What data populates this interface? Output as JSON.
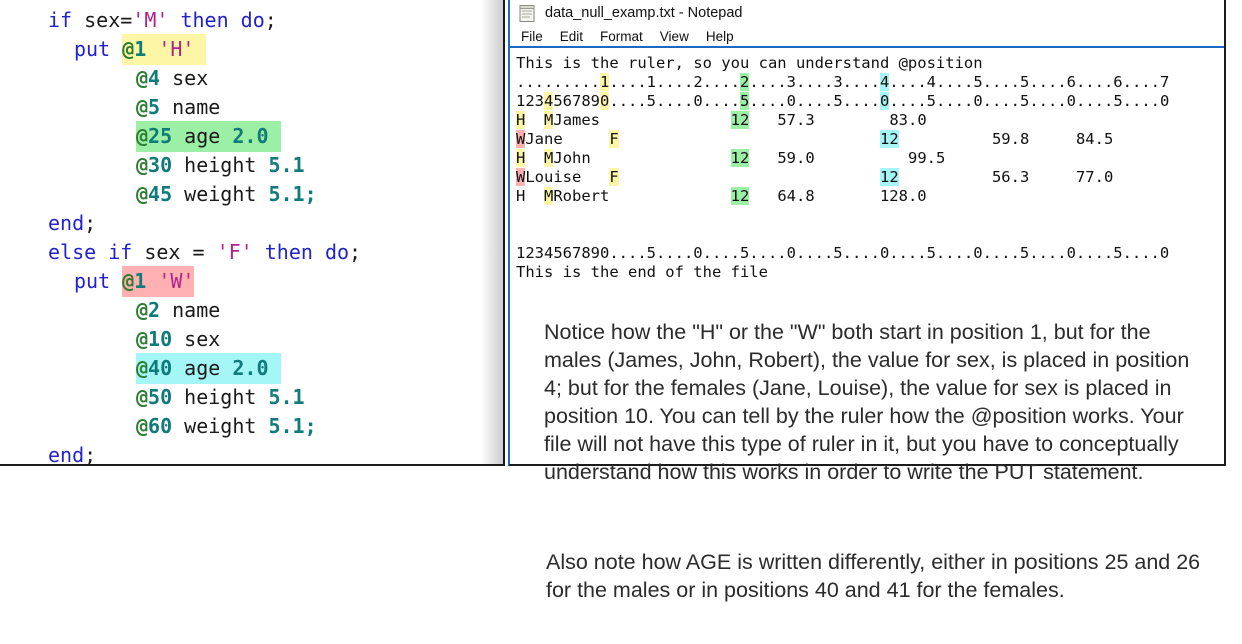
{
  "code_panel": {
    "language": "sas",
    "lines": [
      {
        "indent": "ind1",
        "parts": [
          {
            "t": "if ",
            "c": "kw"
          },
          {
            "t": "sex=",
            "c": "plain"
          },
          {
            "t": "'M'",
            "c": "str"
          },
          {
            "t": " ",
            "c": "plain"
          },
          {
            "t": "then do",
            "c": "kw"
          },
          {
            "t": ";",
            "c": "plain"
          }
        ]
      },
      {
        "indent": "ind2",
        "parts": [
          {
            "t": "put ",
            "c": "kw"
          },
          {
            "t": "@",
            "c": "at",
            "hl": "hl-yellow"
          },
          {
            "t": "1",
            "c": "num",
            "hl": "hl-yellow"
          },
          {
            "t": " ",
            "c": "plain",
            "hl": "hl-yellow"
          },
          {
            "t": "'H'",
            "c": "str",
            "hl": "hl-yellow"
          },
          {
            "t": " ",
            "c": "plain",
            "hl": "hl-yellow"
          }
        ]
      },
      {
        "indent": "ind3",
        "parts": [
          {
            "t": "@",
            "c": "at"
          },
          {
            "t": "4",
            "c": "num"
          },
          {
            "t": " sex",
            "c": "plain"
          }
        ]
      },
      {
        "indent": "ind3",
        "parts": [
          {
            "t": "@",
            "c": "at"
          },
          {
            "t": "5",
            "c": "num"
          },
          {
            "t": " name",
            "c": "plain"
          }
        ]
      },
      {
        "indent": "ind3",
        "parts": [
          {
            "t": "@",
            "c": "at",
            "hl": "hl-green"
          },
          {
            "t": "25",
            "c": "num",
            "hl": "hl-green"
          },
          {
            "t": " age ",
            "c": "plain",
            "hl": "hl-green"
          },
          {
            "t": "2.0",
            "c": "numv",
            "hl": "hl-green"
          },
          {
            "t": " ",
            "c": "plain",
            "hl": "hl-green"
          }
        ]
      },
      {
        "indent": "ind3",
        "parts": [
          {
            "t": "@",
            "c": "at"
          },
          {
            "t": "30",
            "c": "num"
          },
          {
            "t": " height ",
            "c": "plain"
          },
          {
            "t": "5.1",
            "c": "numv"
          }
        ]
      },
      {
        "indent": "ind3",
        "parts": [
          {
            "t": "@",
            "c": "at"
          },
          {
            "t": "45",
            "c": "num"
          },
          {
            "t": " weight ",
            "c": "plain"
          },
          {
            "t": "5.1",
            "c": "numv"
          },
          {
            "t": ";",
            "c": "numv"
          }
        ]
      },
      {
        "indent": "ind1",
        "parts": [
          {
            "t": "end",
            "c": "kw"
          },
          {
            "t": ";",
            "c": "plain"
          }
        ]
      },
      {
        "indent": "ind1",
        "parts": [
          {
            "t": "else if ",
            "c": "kw"
          },
          {
            "t": "sex = ",
            "c": "plain"
          },
          {
            "t": "'F'",
            "c": "str"
          },
          {
            "t": " ",
            "c": "plain"
          },
          {
            "t": "then do",
            "c": "kw"
          },
          {
            "t": ";",
            "c": "plain"
          }
        ]
      },
      {
        "indent": "ind2",
        "parts": [
          {
            "t": "put ",
            "c": "kw"
          },
          {
            "t": "@",
            "c": "at",
            "hl": "hl-pink"
          },
          {
            "t": "1",
            "c": "num",
            "hl": "hl-pink"
          },
          {
            "t": " ",
            "c": "plain",
            "hl": "hl-pink"
          },
          {
            "t": "'W'",
            "c": "str",
            "hl": "hl-pink"
          }
        ]
      },
      {
        "indent": "ind3",
        "parts": [
          {
            "t": "@",
            "c": "at"
          },
          {
            "t": "2",
            "c": "num"
          },
          {
            "t": " name",
            "c": "plain"
          }
        ]
      },
      {
        "indent": "ind3",
        "parts": [
          {
            "t": "@",
            "c": "at"
          },
          {
            "t": "10",
            "c": "num"
          },
          {
            "t": " sex",
            "c": "plain"
          }
        ]
      },
      {
        "indent": "ind3",
        "parts": [
          {
            "t": "@",
            "c": "at",
            "hl": "hl-cyan"
          },
          {
            "t": "40",
            "c": "num",
            "hl": "hl-cyan"
          },
          {
            "t": " age ",
            "c": "plain",
            "hl": "hl-cyan"
          },
          {
            "t": "2.0",
            "c": "numv",
            "hl": "hl-cyan"
          },
          {
            "t": " ",
            "c": "plain",
            "hl": "hl-cyan"
          }
        ]
      },
      {
        "indent": "ind3",
        "parts": [
          {
            "t": "@",
            "c": "at"
          },
          {
            "t": "50",
            "c": "num"
          },
          {
            "t": " height ",
            "c": "plain"
          },
          {
            "t": "5.1",
            "c": "numv"
          }
        ]
      },
      {
        "indent": "ind3",
        "parts": [
          {
            "t": "@",
            "c": "at"
          },
          {
            "t": "60",
            "c": "num"
          },
          {
            "t": " weight ",
            "c": "plain"
          },
          {
            "t": "5.1",
            "c": "numv"
          },
          {
            "t": ";",
            "c": "numv"
          }
        ]
      },
      {
        "indent": "ind1",
        "parts": [
          {
            "t": "end",
            "c": "kw"
          },
          {
            "t": ";",
            "c": "plain"
          }
        ]
      }
    ]
  },
  "notepad": {
    "title": "data_null_examp.txt - Notepad",
    "icon": "notepad-icon",
    "menu": [
      "File",
      "Edit",
      "Format",
      "View",
      "Help"
    ],
    "content_lines": [
      {
        "parts": [
          {
            "t": "This is the ruler, so you can understand @position"
          }
        ]
      },
      {
        "parts": [
          {
            "t": ".........",
            "hl": ""
          },
          {
            "t": "1",
            "hl": "hl-yellow"
          },
          {
            "t": "....1....2....",
            "hl": ""
          },
          {
            "t": "2",
            "hl": "hl-green"
          },
          {
            "t": "....3....3....",
            "hl": ""
          },
          {
            "t": "4",
            "hl": "hl-cyan"
          },
          {
            "t": "....4....5....5....6....6....7",
            "hl": ""
          }
        ]
      },
      {
        "parts": [
          {
            "t": "123",
            "hl": ""
          },
          {
            "t": "4",
            "hl": "hl-yellow"
          },
          {
            "t": "56789",
            "hl": ""
          },
          {
            "t": "0",
            "hl": "hl-yellow"
          },
          {
            "t": "....5....0....",
            "hl": ""
          },
          {
            "t": "5",
            "hl": "hl-green"
          },
          {
            "t": "....0....5....",
            "hl": ""
          },
          {
            "t": "0",
            "hl": "hl-cyan"
          },
          {
            "t": "....5....0....5....0....5....0",
            "hl": ""
          }
        ]
      },
      {
        "parts": [
          {
            "t": "H",
            "hl": "hl-yellow"
          },
          {
            "t": "  ",
            "hl": ""
          },
          {
            "t": "M",
            "hl": "hl-yellow"
          },
          {
            "t": "James              ",
            "hl": ""
          },
          {
            "t": "12",
            "hl": "hl-green"
          },
          {
            "t": "   57.3        83.0",
            "hl": ""
          }
        ]
      },
      {
        "parts": [
          {
            "t": "W",
            "hl": "hl-pink"
          },
          {
            "t": "Jane     ",
            "hl": ""
          },
          {
            "t": "F",
            "hl": "hl-yellow"
          },
          {
            "t": "                            ",
            "hl": ""
          },
          {
            "t": "12",
            "hl": "hl-cyan"
          },
          {
            "t": "          59.8     84.5",
            "hl": ""
          }
        ]
      },
      {
        "parts": [
          {
            "t": "H",
            "hl": "hl-yellow"
          },
          {
            "t": "  ",
            "hl": ""
          },
          {
            "t": "M",
            "hl": "hl-yellow"
          },
          {
            "t": "John               ",
            "hl": ""
          },
          {
            "t": "12",
            "hl": "hl-green"
          },
          {
            "t": "   59.0          99.5",
            "hl": ""
          }
        ]
      },
      {
        "parts": [
          {
            "t": "W",
            "hl": "hl-pink"
          },
          {
            "t": "Louise   ",
            "hl": ""
          },
          {
            "t": "F",
            "hl": "hl-yellow"
          },
          {
            "t": "                            ",
            "hl": ""
          },
          {
            "t": "12",
            "hl": "hl-cyan"
          },
          {
            "t": "          56.3     77.0",
            "hl": ""
          }
        ]
      },
      {
        "parts": [
          {
            "t": "H  ",
            "hl": ""
          },
          {
            "t": "M",
            "hl": "hl-yellow"
          },
          {
            "t": "Robert             ",
            "hl": ""
          },
          {
            "t": "12",
            "hl": "hl-green"
          },
          {
            "t": "   64.8       128.0",
            "hl": ""
          }
        ]
      },
      {
        "parts": [
          {
            "t": " "
          }
        ]
      },
      {
        "parts": [
          {
            "t": " "
          }
        ]
      },
      {
        "parts": [
          {
            "t": "1234567890....5....0....5....0....5....0....5....0....5....0....5....0"
          }
        ]
      },
      {
        "parts": [
          {
            "t": "This is the end of the file"
          }
        ]
      }
    ]
  },
  "notes": {
    "note_1": "Notice how the \"H\" or the \"W\" both start in position 1, but for the males (James, John, Robert), the value for sex, is placed in position 4; but for the females (Jane, Louise), the value for sex is placed in position 10. You can tell by the ruler how the @position works. Your file will not have this type of ruler in it, but you have to conceptually understand how this works in order to write the PUT statement.",
    "note_2": "Also note how AGE is written differently, either in positions 25 and 26 for the males or in positions 40 and 41 for the females."
  },
  "colors": {
    "highlight_yellow": "#fdf6a6",
    "highlight_green": "#9bf0a6",
    "highlight_pink": "#ffb1b1",
    "highlight_cyan": "#a5f6f6",
    "keyword_blue": "#2222cc",
    "string_magenta": "#b0228c",
    "at_green": "#2e7d32",
    "number_teal": "#0f7b7b",
    "window_border": "#1b1b1b",
    "accent_blue": "#1b69c3"
  }
}
